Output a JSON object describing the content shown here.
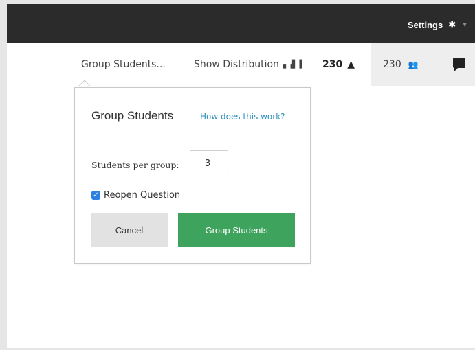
{
  "header": {
    "settings_label": "Settings",
    "settings_icon": "gear-icon",
    "caret_icon": "caret-down-icon"
  },
  "toolbar": {
    "group_students_label": "Group Students...",
    "show_distribution_label": "Show Distribution",
    "distribution_icon": "bar-chart-icon",
    "submissions_count": "230",
    "submissions_icon": "inbox-download-icon",
    "students_count": "230",
    "students_icon": "people-icon",
    "chat_icon": "chat-icon"
  },
  "popover": {
    "title": "Group Students",
    "help_link": "How does this work?",
    "students_per_group_label": "Students per group:",
    "students_per_group_value": "3",
    "reopen_label": "Reopen Question",
    "reopen_checked": true,
    "cancel_label": "Cancel",
    "submit_label": "Group Students"
  },
  "colors": {
    "topbar": "#2b2b2b",
    "link": "#2a8fbd",
    "primary_button": "#3da35d",
    "checkbox": "#2d7fe0"
  }
}
